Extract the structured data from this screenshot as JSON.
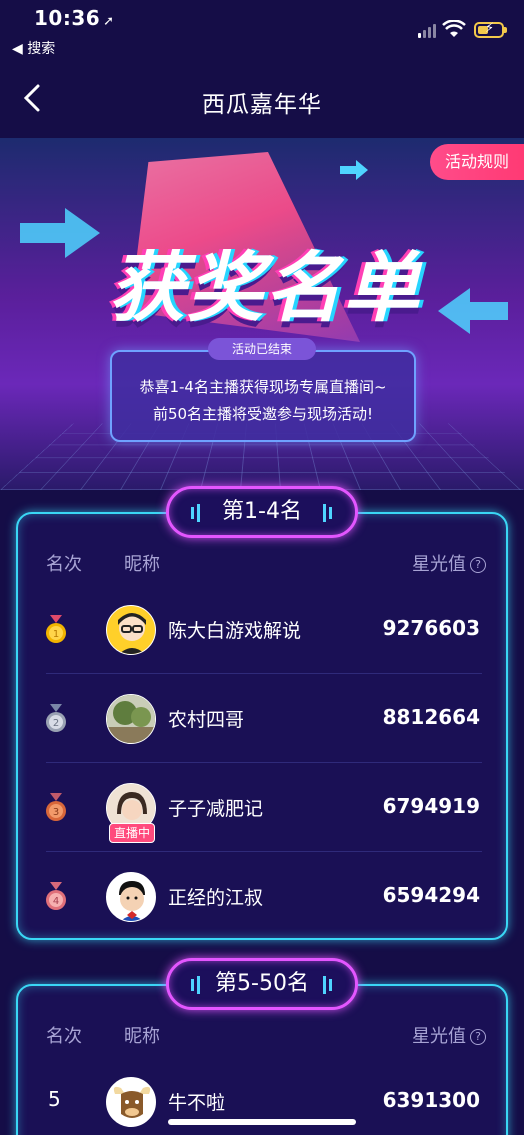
{
  "status_bar": {
    "time": "10:36",
    "back_app": "◀ 搜索"
  },
  "nav": {
    "title": "西瓜嘉年华"
  },
  "banner": {
    "title": "获奖名单",
    "rules_button": "活动规则",
    "status_badge": "活动已结束",
    "notice_line1": "恭喜1-4名主播获得现场专属直播间~",
    "notice_line2": "前50名主播将受邀参与现场活动!"
  },
  "columns": {
    "rank": "名次",
    "nickname": "昵称",
    "score": "星光值"
  },
  "section1": {
    "title": "第1-4名",
    "rows": [
      {
        "rank": "1",
        "name": "陈大白游戏解说",
        "score": "9276603",
        "medal_color": "#f2b400"
      },
      {
        "rank": "2",
        "name": "农村四哥",
        "score": "8812664",
        "medal_color": "#b9bec8"
      },
      {
        "rank": "3",
        "name": "子子减肥记",
        "score": "6794919",
        "medal_color": "#e07a4a",
        "live": "直播中"
      },
      {
        "rank": "4",
        "name": "正经的江叔",
        "score": "6594294",
        "medal_color": "#f08a8a"
      }
    ]
  },
  "section2": {
    "title": "第5-50名",
    "rows": [
      {
        "rank": "5",
        "name": "牛不啦",
        "score": "6391300"
      }
    ]
  }
}
